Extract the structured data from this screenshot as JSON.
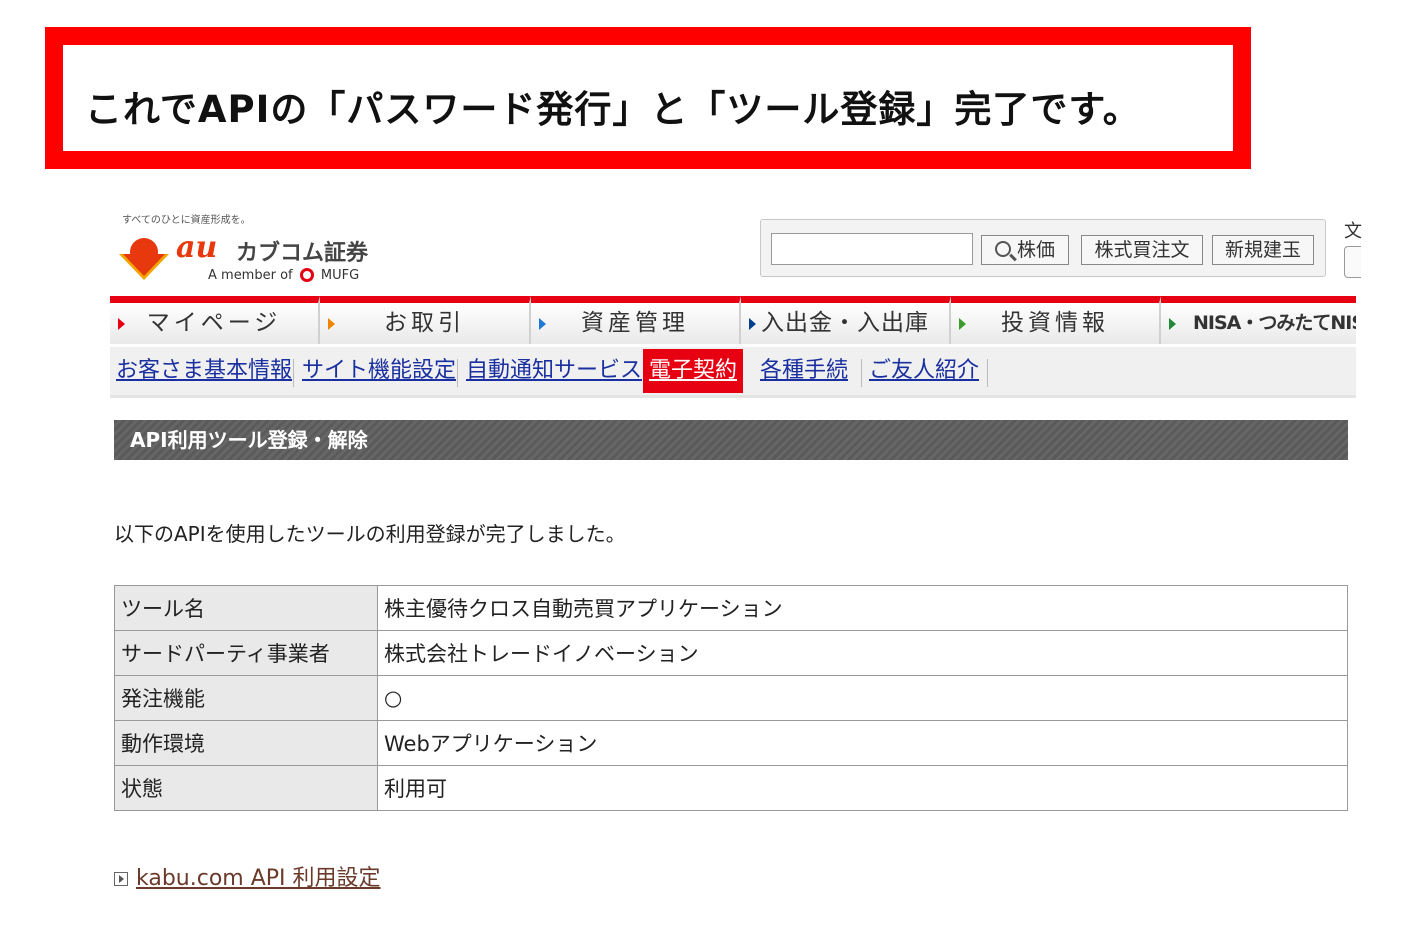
{
  "banner": {
    "text": "これでAPIの「パスワード発行」と「ツール登録」完了です。"
  },
  "header": {
    "tagline": "すべてのひとに資産形成を。",
    "logo_au": "au",
    "logo_name": "カブコム証券",
    "member_prefix": "A member of",
    "member_brand": "MUFG",
    "search_input_value": "",
    "buttons": {
      "stock_price": "株価",
      "stock_order": "株式買注文",
      "new_position": "新規建玉"
    },
    "cut_char": "文"
  },
  "mainnav": {
    "tabs": [
      {
        "label": "マイページ",
        "arrow_color": "#e60012"
      },
      {
        "label": "お取引",
        "arrow_color": "#f08300"
      },
      {
        "label": "資産管理",
        "arrow_color": "#1b7ad6"
      },
      {
        "label": "入出金・入出庫",
        "arrow_color": "#003f8e"
      },
      {
        "label": "投資情報",
        "arrow_color": "#3c9a2a"
      },
      {
        "label": "NISA・つみたてNISA",
        "arrow_color": "#1f8a3a"
      }
    ]
  },
  "subnav": {
    "items": [
      {
        "label": "お客さま基本情報"
      },
      {
        "label": "サイト機能設定"
      },
      {
        "label": "自動通知サービス"
      },
      {
        "label": "電子契約",
        "active": true
      },
      {
        "label": "各種手続"
      },
      {
        "label": "ご友人紹介"
      }
    ]
  },
  "section": {
    "title": "API利用ツール登録・解除"
  },
  "message": "以下のAPIを使用したツールの利用登録が完了しました。",
  "table": {
    "rows": [
      {
        "key": "ツール名",
        "value": "株主優待クロス自動売買アプリケーション"
      },
      {
        "key": "サードパーティ事業者",
        "value": "株式会社トレードイノベーション"
      },
      {
        "key": "発注機能",
        "value": "○"
      },
      {
        "key": "動作環境",
        "value": "Webアプリケーション"
      },
      {
        "key": "状態",
        "value": "利用可"
      }
    ]
  },
  "footer_link": {
    "label": "kabu.com API 利用設定"
  },
  "colors": {
    "accent": "#e60012",
    "banner_border": "#ff0000",
    "link": "#1a2fa0"
  }
}
